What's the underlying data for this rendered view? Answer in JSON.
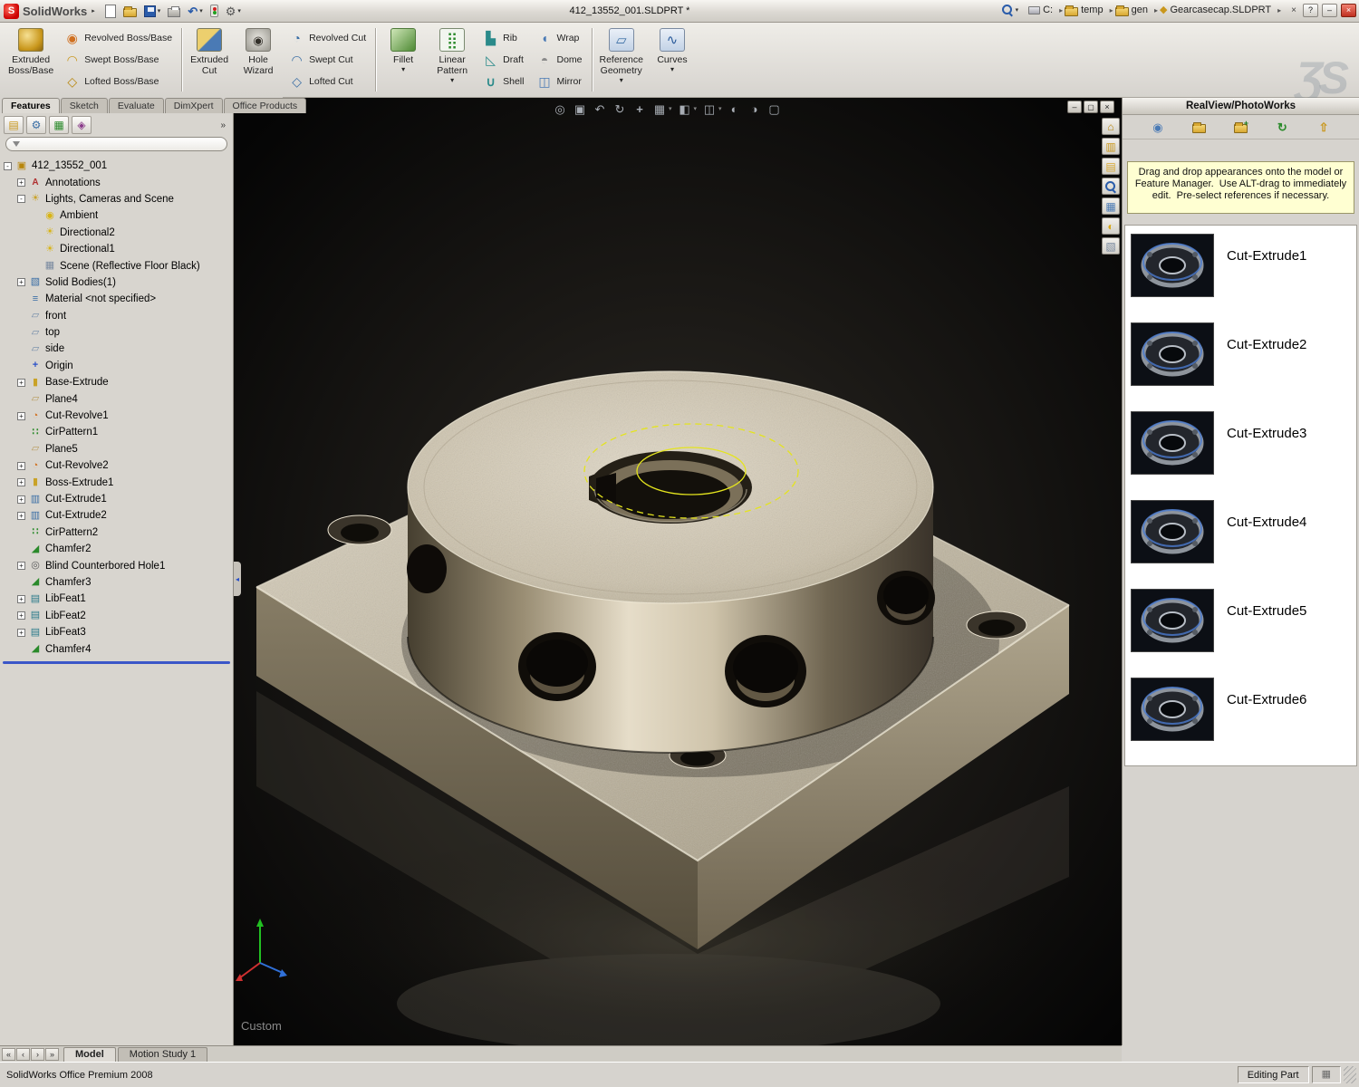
{
  "colors": {
    "window_chrome": "#d6d3ce",
    "viewport_background": "#0a0a0a",
    "sketch_highlight": "#e4e41e",
    "rollback_bar": "#3a56c8",
    "instruction_box": "#ffffd2",
    "close_button_red": "#c03020",
    "metal_light": "#ddd5c3",
    "metal_shadow": "#463f30"
  },
  "titlebar": {
    "app_name": "SolidWorks",
    "document_title": "412_13552_001.SLDPRT *",
    "tools": [
      {
        "name": "new-document-icon",
        "caret": ""
      },
      {
        "name": "open-icon",
        "caret": ""
      },
      {
        "name": "save-icon",
        "caret": "▾"
      },
      {
        "name": "print-icon",
        "caret": ""
      },
      {
        "name": "undo-icon",
        "caret": "▾"
      },
      {
        "name": "rebuild-icon",
        "caret": ""
      },
      {
        "name": "options-icon",
        "caret": "▾"
      }
    ],
    "breadcrumbs": [
      {
        "icon": "drive-icon",
        "label": "C:"
      },
      {
        "icon": "folder-icon",
        "label": "temp"
      },
      {
        "icon": "folder-icon",
        "label": "gen"
      },
      {
        "icon": "part-document-icon",
        "label": "Gearcasecap.SLDPRT"
      }
    ],
    "breadcrumb_close": "×",
    "help_label": "?"
  },
  "command_manager": {
    "watermark": "ƷS",
    "tabs": [
      {
        "label": "Features",
        "active": "true"
      },
      {
        "label": "Sketch",
        "active": "false"
      },
      {
        "label": "Evaluate",
        "active": "false"
      },
      {
        "label": "DimXpert",
        "active": "false"
      },
      {
        "label": "Office Products",
        "active": "false"
      }
    ],
    "large": [
      {
        "l1": "Extruded",
        "l2": "Boss/Base",
        "caret": ""
      },
      {
        "l1": "Extruded",
        "l2": "Cut",
        "caret": ""
      },
      {
        "l1": "Hole",
        "l2": "Wizard",
        "caret": ""
      },
      {
        "l1": "Fillet",
        "l2": "",
        "caret": "▾"
      },
      {
        "l1": "Linear",
        "l2": "Pattern",
        "caret": "▾"
      },
      {
        "l1": "Reference",
        "l2": "Geometry",
        "caret": "▾"
      },
      {
        "l1": "Curves",
        "l2": "",
        "caret": "▾"
      }
    ],
    "stacks": [
      [
        {
          "label": "Revolved Boss/Base",
          "icon": "revolved-boss-icon",
          "name": "revolved-boss-base-button"
        },
        {
          "label": "Swept Boss/Base",
          "icon": "swept-boss-icon",
          "name": "swept-boss-base-button"
        },
        {
          "label": "Lofted Boss/Base",
          "icon": "lofted-boss-icon",
          "name": "lofted-boss-base-button"
        }
      ],
      [
        {
          "label": "Revolved Cut",
          "icon": "revolved-cut-icon",
          "name": "revolved-cut-button"
        },
        {
          "label": "Swept Cut",
          "icon": "swept-cut-icon",
          "name": "swept-cut-button"
        },
        {
          "label": "Lofted Cut",
          "icon": "lofted-cut-icon",
          "name": "lofted-cut-button"
        }
      ],
      [
        {
          "label": "Rib",
          "icon": "rib-icon",
          "name": "rib-button"
        },
        {
          "label": "Draft",
          "icon": "draft-icon",
          "name": "draft-button"
        },
        {
          "label": "Shell",
          "icon": "shell-icon",
          "name": "shell-button"
        }
      ],
      [
        {
          "label": "Wrap",
          "icon": "wrap-icon",
          "name": "wrap-button"
        },
        {
          "label": "Dome",
          "icon": "dome-icon",
          "name": "dome-button"
        },
        {
          "label": "Mirror",
          "icon": "mirror-icon",
          "name": "mirror-button"
        }
      ]
    ]
  },
  "left_panel": {
    "manager_tabs": [
      "featuremanager-tab-icon",
      "propertymanager-tab-icon",
      "configurationmanager-tab-icon",
      "dimxpertmanager-tab-icon"
    ],
    "overflow_label": "»",
    "filter_placeholder": ""
  },
  "feature_tree": {
    "items": [
      {
        "label": "412_13552_001",
        "depth": 0,
        "exp": "-",
        "icon": "part-icon"
      },
      {
        "label": "Annotations",
        "depth": 1,
        "exp": "+",
        "icon": "annotations-icon"
      },
      {
        "label": "Lights, Cameras and Scene",
        "depth": 1,
        "exp": "-",
        "icon": "lights-icon"
      },
      {
        "label": "Ambient",
        "depth": 2,
        "exp": "",
        "icon": "ambient-light-icon"
      },
      {
        "label": "Directional2",
        "depth": 2,
        "exp": "",
        "icon": "directional-light-icon"
      },
      {
        "label": "Directional1",
        "depth": 2,
        "exp": "",
        "icon": "directional-light-icon"
      },
      {
        "label": "Scene (Reflective Floor Black)",
        "depth": 2,
        "exp": "",
        "icon": "scene-icon"
      },
      {
        "label": "Solid Bodies(1)",
        "depth": 1,
        "exp": "+",
        "icon": "solid-bodies-icon"
      },
      {
        "label": "Material <not specified>",
        "depth": 1,
        "exp": "",
        "icon": "material-icon"
      },
      {
        "label": "front",
        "depth": 1,
        "exp": "",
        "icon": "plane-icon"
      },
      {
        "label": "top",
        "depth": 1,
        "exp": "",
        "icon": "plane-icon"
      },
      {
        "label": "side",
        "depth": 1,
        "exp": "",
        "icon": "plane-icon"
      },
      {
        "label": "Origin",
        "depth": 1,
        "exp": "",
        "icon": "origin-icon"
      },
      {
        "label": "Base-Extrude",
        "depth": 1,
        "exp": "+",
        "icon": "extrude-icon"
      },
      {
        "label": "Plane4",
        "depth": 1,
        "exp": "",
        "icon": "ref-plane-icon"
      },
      {
        "label": "Cut-Revolve1",
        "depth": 1,
        "exp": "+",
        "icon": "cut-revolve-icon"
      },
      {
        "label": "CirPattern1",
        "depth": 1,
        "exp": "",
        "icon": "circular-pattern-icon"
      },
      {
        "label": "Plane5",
        "depth": 1,
        "exp": "",
        "icon": "ref-plane-icon"
      },
      {
        "label": "Cut-Revolve2",
        "depth": 1,
        "exp": "+",
        "icon": "cut-revolve-icon"
      },
      {
        "label": "Boss-Extrude1",
        "depth": 1,
        "exp": "+",
        "icon": "extrude-icon"
      },
      {
        "label": "Cut-Extrude1",
        "depth": 1,
        "exp": "+",
        "icon": "cut-extrude-icon"
      },
      {
        "label": "Cut-Extrude2",
        "depth": 1,
        "exp": "+",
        "icon": "cut-extrude-icon"
      },
      {
        "label": "CirPattern2",
        "depth": 1,
        "exp": "",
        "icon": "circular-pattern-icon"
      },
      {
        "label": "Chamfer2",
        "depth": 1,
        "exp": "",
        "icon": "chamfer-icon"
      },
      {
        "label": "Blind Counterbored Hole1",
        "depth": 1,
        "exp": "+",
        "icon": "hole-icon"
      },
      {
        "label": "Chamfer3",
        "depth": 1,
        "exp": "",
        "icon": "chamfer-icon"
      },
      {
        "label": "LibFeat1",
        "depth": 1,
        "exp": "+",
        "icon": "libfeat-icon"
      },
      {
        "label": "LibFeat2",
        "depth": 1,
        "exp": "+",
        "icon": "libfeat-icon"
      },
      {
        "label": "LibFeat3",
        "depth": 1,
        "exp": "+",
        "icon": "libfeat-icon"
      },
      {
        "label": "Chamfer4",
        "depth": 1,
        "exp": "",
        "icon": "chamfer-icon"
      }
    ]
  },
  "viewport": {
    "toolbar": [
      {
        "name": "zoom-fit-icon",
        "caret": ""
      },
      {
        "name": "zoom-area-icon",
        "caret": ""
      },
      {
        "name": "previous-view-icon",
        "caret": ""
      },
      {
        "name": "rotate-view-icon",
        "caret": ""
      },
      {
        "name": "pan-icon",
        "caret": ""
      },
      {
        "name": "standard-views-icon",
        "caret": "▾"
      },
      {
        "name": "display-style-icon",
        "caret": "▾"
      },
      {
        "name": "section-view-icon",
        "caret": "▾"
      },
      {
        "name": "realview-icon",
        "caret": ""
      },
      {
        "name": "shadows-icon",
        "caret": ""
      },
      {
        "name": "camera-icon",
        "caret": ""
      }
    ],
    "window_buttons": [
      "minimize-icon",
      "restore-icon",
      "close-icon"
    ],
    "task_pane_tabs": [
      "solidworks-resources-icon",
      "design-library-icon",
      "file-explorer-icon",
      "search-icon",
      "view-palette-icon",
      "appearances-icon",
      "custom-properties-icon"
    ],
    "custom_label": "Custom"
  },
  "task_pane": {
    "title": "RealView/PhotoWorks",
    "header_icons": [
      "pin-icon",
      "open-folder-icon",
      "new-folder-icon",
      "refresh-icon",
      "apply-icon"
    ],
    "instruction": "Drag and drop appearances onto the model or Feature Manager.  Use ALT-drag to immediately edit.  Pre-select references if necessary.",
    "items": [
      "Cut-Extrude1",
      "Cut-Extrude2",
      "Cut-Extrude3",
      "Cut-Extrude4",
      "Cut-Extrude5",
      "Cut-Extrude6"
    ]
  },
  "bottom_bar": {
    "nav_icons": [
      "first-tab-icon",
      "prev-tab-icon",
      "next-tab-icon",
      "last-tab-icon"
    ],
    "tabs": [
      {
        "label": "Model",
        "active": "true"
      },
      {
        "label": "Motion Study 1",
        "active": "false"
      }
    ]
  },
  "status_bar": {
    "left": "SolidWorks Office Premium 2008",
    "mode": "Editing Part"
  }
}
